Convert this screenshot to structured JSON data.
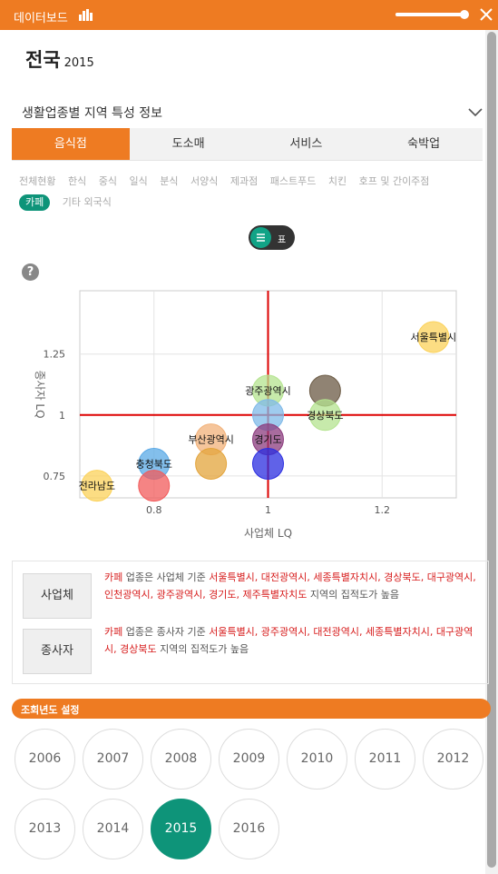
{
  "header": {
    "title": "데이터보드",
    "zoom_level": 0.95,
    "colors": {
      "accent": "#ee7b22",
      "active": "#0e9479"
    }
  },
  "region": {
    "name": "전국",
    "year": "2015"
  },
  "section": {
    "title": "생활업종별 지역 특성 정보"
  },
  "tabs": [
    {
      "label": "음식점",
      "active": true
    },
    {
      "label": "도소매",
      "active": false
    },
    {
      "label": "서비스",
      "active": false
    },
    {
      "label": "숙박업",
      "active": false
    }
  ],
  "subcategories": [
    {
      "label": "전체현황",
      "active": false
    },
    {
      "label": "한식",
      "active": false
    },
    {
      "label": "중식",
      "active": false
    },
    {
      "label": "일식",
      "active": false
    },
    {
      "label": "분식",
      "active": false
    },
    {
      "label": "서양식",
      "active": false
    },
    {
      "label": "제과점",
      "active": false
    },
    {
      "label": "패스트푸드",
      "active": false
    },
    {
      "label": "치킨",
      "active": false
    },
    {
      "label": "호프 및 간이주점",
      "active": false
    },
    {
      "label": "카페",
      "active": true
    },
    {
      "label": "기타 외국식",
      "active": false
    }
  ],
  "view_toggle": {
    "label": "표"
  },
  "help": {
    "label": "?"
  },
  "chart_data": {
    "type": "scatter",
    "xlabel": "사업체 LQ",
    "ylabel": "종사자 LQ",
    "xlim": [
      0.67,
      1.33
    ],
    "ylim": [
      0.66,
      1.51
    ],
    "x_ticks": [
      "0.8",
      "1",
      "1.2"
    ],
    "y_ticks": [
      "0.75",
      "1",
      "1.25"
    ],
    "reference_lines": {
      "x": 1,
      "y": 1,
      "color": "#dd0000"
    },
    "grid": true,
    "points": [
      {
        "label": "서울특별시",
        "x": 1.29,
        "y": 1.32,
        "color": "#fbd25a"
      },
      {
        "label": "광주광역시",
        "x": 1.0,
        "y": 1.1,
        "color": "#b4e38f"
      },
      {
        "label": "",
        "x": 1.1,
        "y": 1.1,
        "color": "#6b5a44"
      },
      {
        "label": "",
        "x": 1.0,
        "y": 1.0,
        "color": "#7fb9e8"
      },
      {
        "label": "경상북도",
        "x": 1.1,
        "y": 1.0,
        "color": "#b4e38f"
      },
      {
        "label": "부산광역시",
        "x": 0.9,
        "y": 0.9,
        "color": "#f2b27a"
      },
      {
        "label": "경기도",
        "x": 1.0,
        "y": 0.9,
        "color": "#8b3b7d"
      },
      {
        "label": "충청북도",
        "x": 0.8,
        "y": 0.8,
        "color": "#5aa9e6"
      },
      {
        "label": "",
        "x": 0.9,
        "y": 0.8,
        "color": "#e3a43b"
      },
      {
        "label": "",
        "x": 1.0,
        "y": 0.8,
        "color": "#2b2ee0"
      },
      {
        "label": "",
        "x": 0.8,
        "y": 0.71,
        "color": "#f25b5b"
      },
      {
        "label": "전라남도",
        "x": 0.7,
        "y": 0.71,
        "color": "#fbd25a"
      }
    ]
  },
  "info": {
    "business": {
      "button": "사업체",
      "category": "카페",
      "prefix": " 업종은 사업체 기준  ",
      "regions": "서울특별시, 대전광역시, 세종특별자치시, 경상북도, 대구광역시, 인천광역시, 광주광역시, 경기도, 제주특별자치도",
      "suffix": " 지역의 집적도가 높음"
    },
    "employee": {
      "button": "종사자",
      "category": "카페",
      "prefix": " 업종은 종사자 기준  ",
      "regions": "서울특별시, 광주광역시, 대전광역시, 세종특별자치시, 대구광역시, 경상북도",
      "suffix": " 지역의 집적도가 높음"
    }
  },
  "year_settings": {
    "title": "조회년도 설정",
    "years": [
      "2006",
      "2007",
      "2008",
      "2009",
      "2010",
      "2011",
      "2012",
      "2013",
      "2014",
      "2015",
      "2016"
    ],
    "selected": "2015"
  }
}
